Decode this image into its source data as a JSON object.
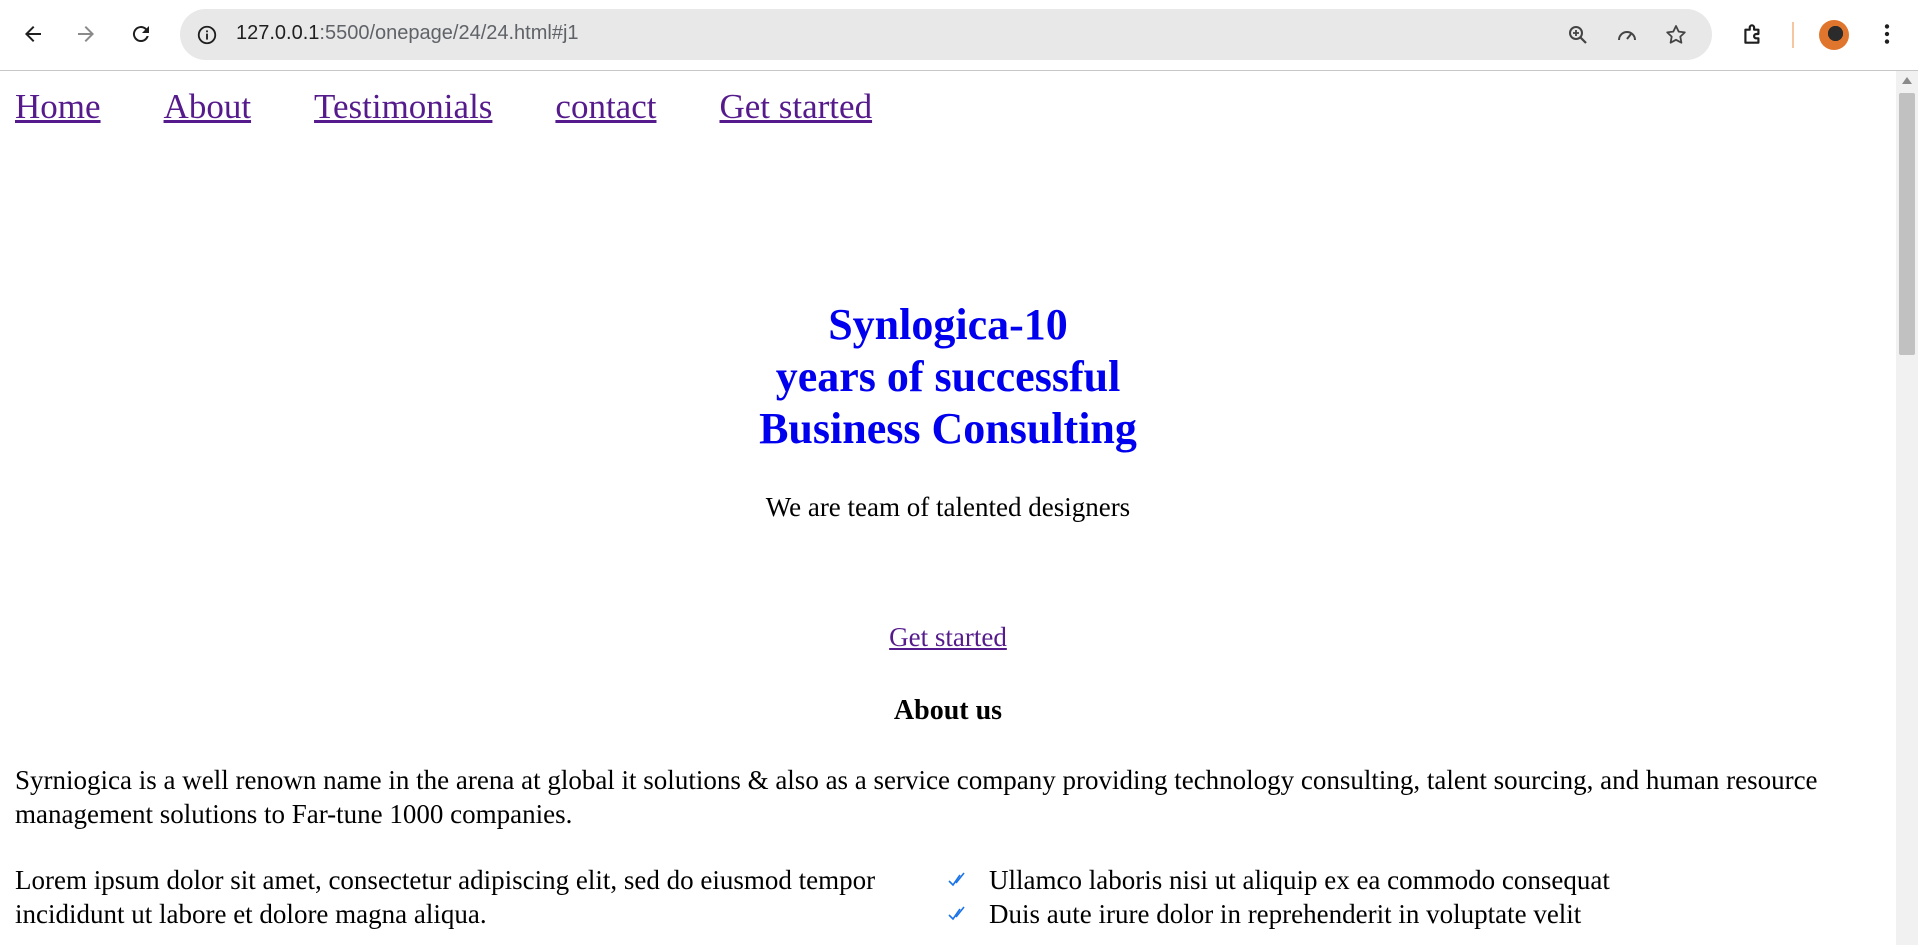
{
  "browser": {
    "url_host": "127.0.0.1",
    "url_path": ":5500/onepage/24/24.html#j1",
    "icons": {
      "back": "arrow-left-icon",
      "forward": "arrow-right-icon",
      "reload": "reload-icon",
      "site_info": "info-icon",
      "zoom": "zoom-icon",
      "performance": "gauge-icon",
      "bookmark": "star-icon",
      "extensions": "puzzle-icon",
      "menu": "kebab-menu-icon"
    }
  },
  "nav": {
    "items": [
      {
        "label": "Home"
      },
      {
        "label": "About"
      },
      {
        "label": "Testimonials"
      },
      {
        "label": "contact"
      },
      {
        "label": "Get started"
      }
    ]
  },
  "hero": {
    "title_lines": [
      "Synlogica-10",
      "years of successful",
      "Business Consulting"
    ],
    "subtitle": "We are team of talented designers",
    "cta_label": "Get started"
  },
  "about": {
    "heading": "About us",
    "text": "Syrniogica is a well renown name in the arena at global it solutions & also as a service company providing technology consulting, talent sourcing, and human resource management solutions to Far-tune 1000 companies.",
    "lorem": "Lorem ipsum dolor sit amet, consectetur adipiscing elit, sed do eiusmod tempor incididunt ut labore et dolore magna aliqua.",
    "checklist": [
      "Ullamco laboris nisi ut aliquip ex ea commodo consequat",
      "Duis aute irure dolor in reprehenderit in voluptate velit"
    ]
  },
  "colors": {
    "title": "#0000ee",
    "link_visited": "#551a8b",
    "check": "#1a73e8"
  }
}
